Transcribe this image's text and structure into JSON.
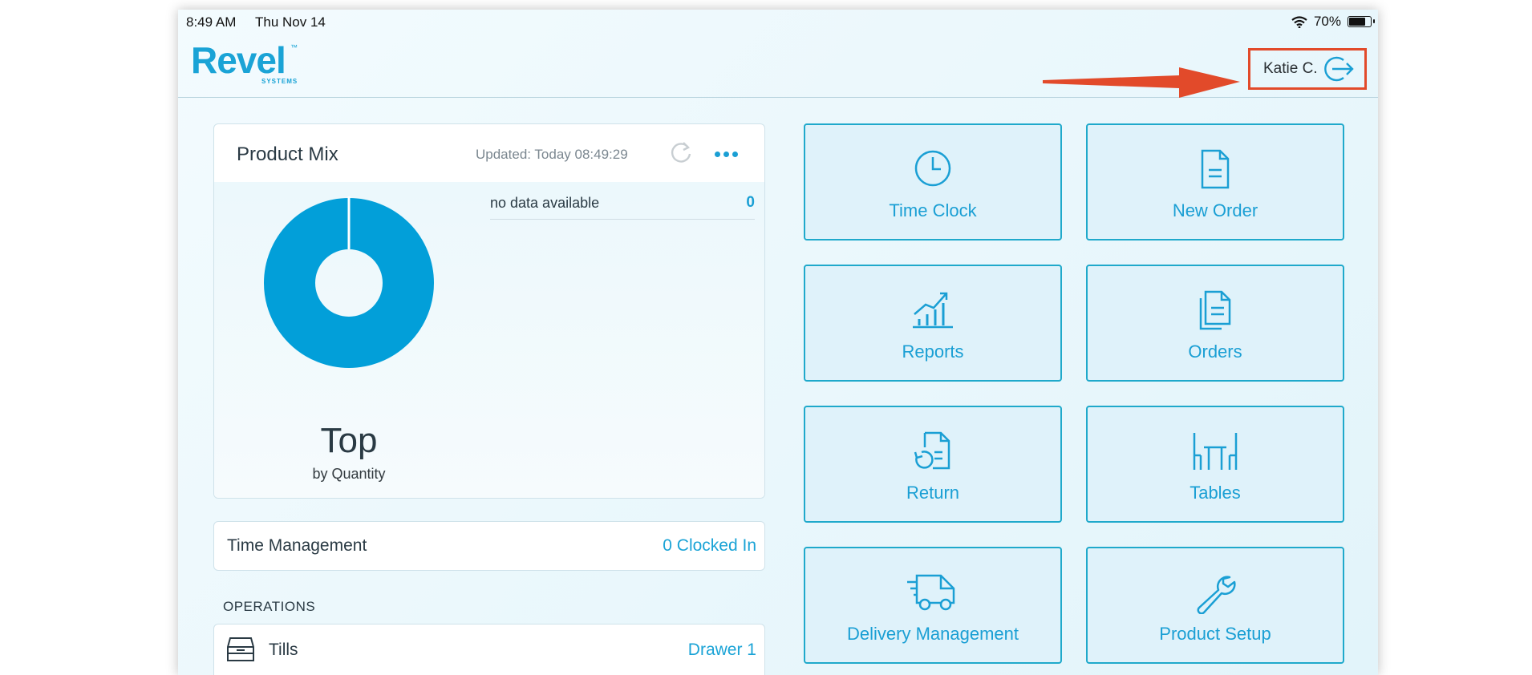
{
  "status_bar": {
    "time": "8:49 AM",
    "date": "Thu Nov 14",
    "battery": "70%",
    "battery_level": 0.7
  },
  "header": {
    "brand": "Revel",
    "brand_tm": "™",
    "brand_sub": "SYSTEMS",
    "user_name": "Katie C."
  },
  "product_mix": {
    "title": "Product Mix",
    "updated": "Updated: Today 08:49:29",
    "top_label": "Top",
    "by_label": "by Quantity",
    "legend_label": "no data available",
    "legend_value": "0"
  },
  "time_management": {
    "label": "Time Management",
    "value": "0 Clocked In"
  },
  "operations": {
    "heading": "OPERATIONS",
    "tills_label": "Tills",
    "tills_value": "Drawer 1"
  },
  "tiles": [
    {
      "label": "Time Clock",
      "icon": "clock-icon"
    },
    {
      "label": "New Order",
      "icon": "document-icon"
    },
    {
      "label": "Reports",
      "icon": "chart-icon"
    },
    {
      "label": "Orders",
      "icon": "documents-icon"
    },
    {
      "label": "Return",
      "icon": "return-icon"
    },
    {
      "label": "Tables",
      "icon": "tables-icon"
    },
    {
      "label": "Delivery Management",
      "icon": "truck-icon"
    },
    {
      "label": "Product Setup",
      "icon": "wrench-icon"
    }
  ],
  "colors": {
    "accent": "#1aa3d6",
    "highlight": "#e24a2a",
    "tile_bg": "#dff2fa",
    "tile_border": "#1fa9cb"
  }
}
